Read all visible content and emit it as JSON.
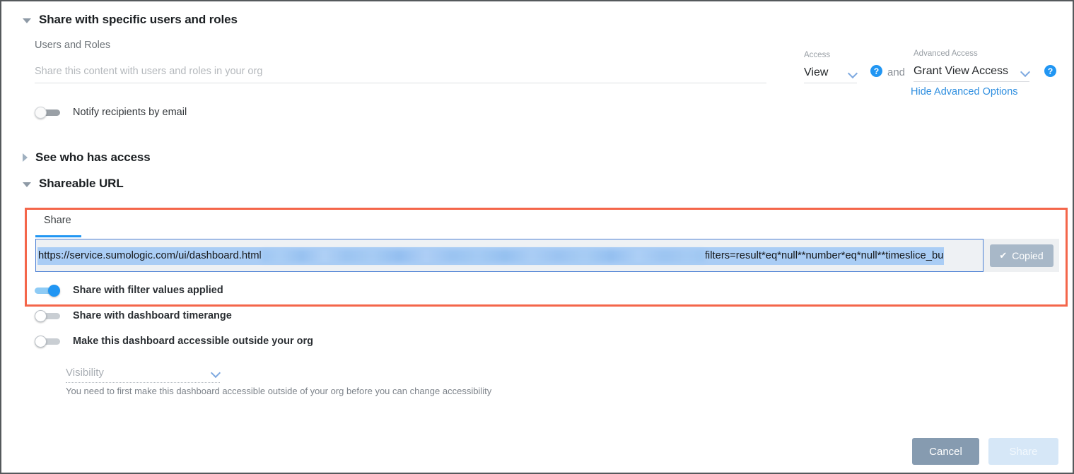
{
  "sections": {
    "share_users": {
      "title": "Share with specific users and roles",
      "caret": "caret-down-icon"
    },
    "who_has_access": {
      "title": "See who has access",
      "caret": "caret-right-icon"
    },
    "shareable_url": {
      "title": "Shareable URL",
      "caret": "caret-down-icon"
    }
  },
  "users_and_roles": {
    "label": "Users and Roles",
    "placeholder": "Share this content with users and roles in your org",
    "value": ""
  },
  "access": {
    "label": "Access",
    "value": "View",
    "help_icon": "help-circle-icon",
    "conjunction": "and",
    "advanced_label": "Advanced Access",
    "advanced_value": "Grant View Access",
    "advanced_help_icon": "help-circle-icon",
    "toggle_advanced_link": "Hide Advanced Options"
  },
  "notify": {
    "label": "Notify recipients by email",
    "state": "off"
  },
  "url_panel": {
    "tab_label": "Share",
    "url_prefix": "https://service.sumologic.com/ui/dashboard.html",
    "url_redacted": "[redacted]",
    "url_suffix": "filters=result*eq*null**number*eq*null**timeslice_bu",
    "copy_button": "Copied",
    "copy_icon": "check-icon",
    "highlight_color": "#aacdf5"
  },
  "toggles": [
    {
      "label": "Share with filter values applied",
      "state": "on"
    },
    {
      "label": "Share with dashboard timerange",
      "state": "off"
    },
    {
      "label": "Make this dashboard accessible outside your org",
      "state": "off"
    }
  ],
  "visibility": {
    "placeholder": "Visibility",
    "hint": "You need to first make this dashboard accessible outside of your org before you can change accessibility",
    "chevron": "chevron-down-icon"
  },
  "footer": {
    "cancel": "Cancel",
    "share": "Share"
  },
  "annotation": {
    "color": "#f4664a"
  }
}
